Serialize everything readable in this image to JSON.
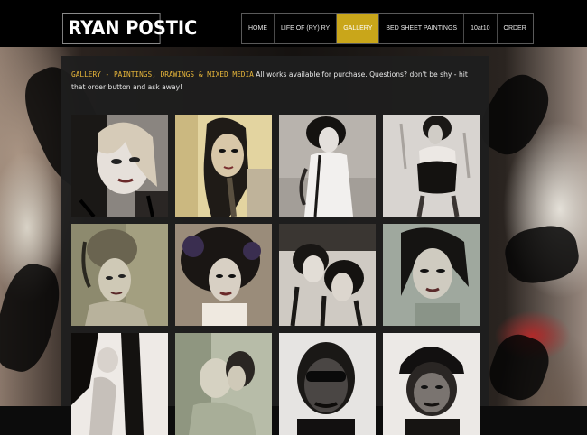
{
  "site": {
    "logo": "RYAN POSTIC"
  },
  "nav": {
    "items": [
      {
        "label": "HOME",
        "active": false
      },
      {
        "label": "LIFE OF (RY) RY",
        "active": false
      },
      {
        "label": "GALLERY",
        "active": true
      },
      {
        "label": "BED SHEET PAINTINGS",
        "active": false
      },
      {
        "label": "10at10",
        "active": false
      },
      {
        "label": "ORDER",
        "active": false
      }
    ]
  },
  "intro": {
    "heading": "GALLERY - PAINTINGS, DRAWINGS & MIXED MEDIA",
    "text": " All works available for purchase. Questions? don't be shy - hit that order button and ask away!"
  },
  "colors": {
    "accent": "#c9a61a",
    "heading": "#e7b63a",
    "panel": "#1e1e1e"
  },
  "gallery": {
    "thumbnails": [
      "woman-portrait-blonde",
      "woman-portrait-yellow",
      "woman-figure-white",
      "woman-bodice",
      "woman-updo-hair",
      "woman-afro-hair",
      "women-double-portrait",
      "woman-portrait-teal",
      "figure-black-white",
      "couple-kiss",
      "man-sunglasses",
      "man-cap"
    ]
  }
}
